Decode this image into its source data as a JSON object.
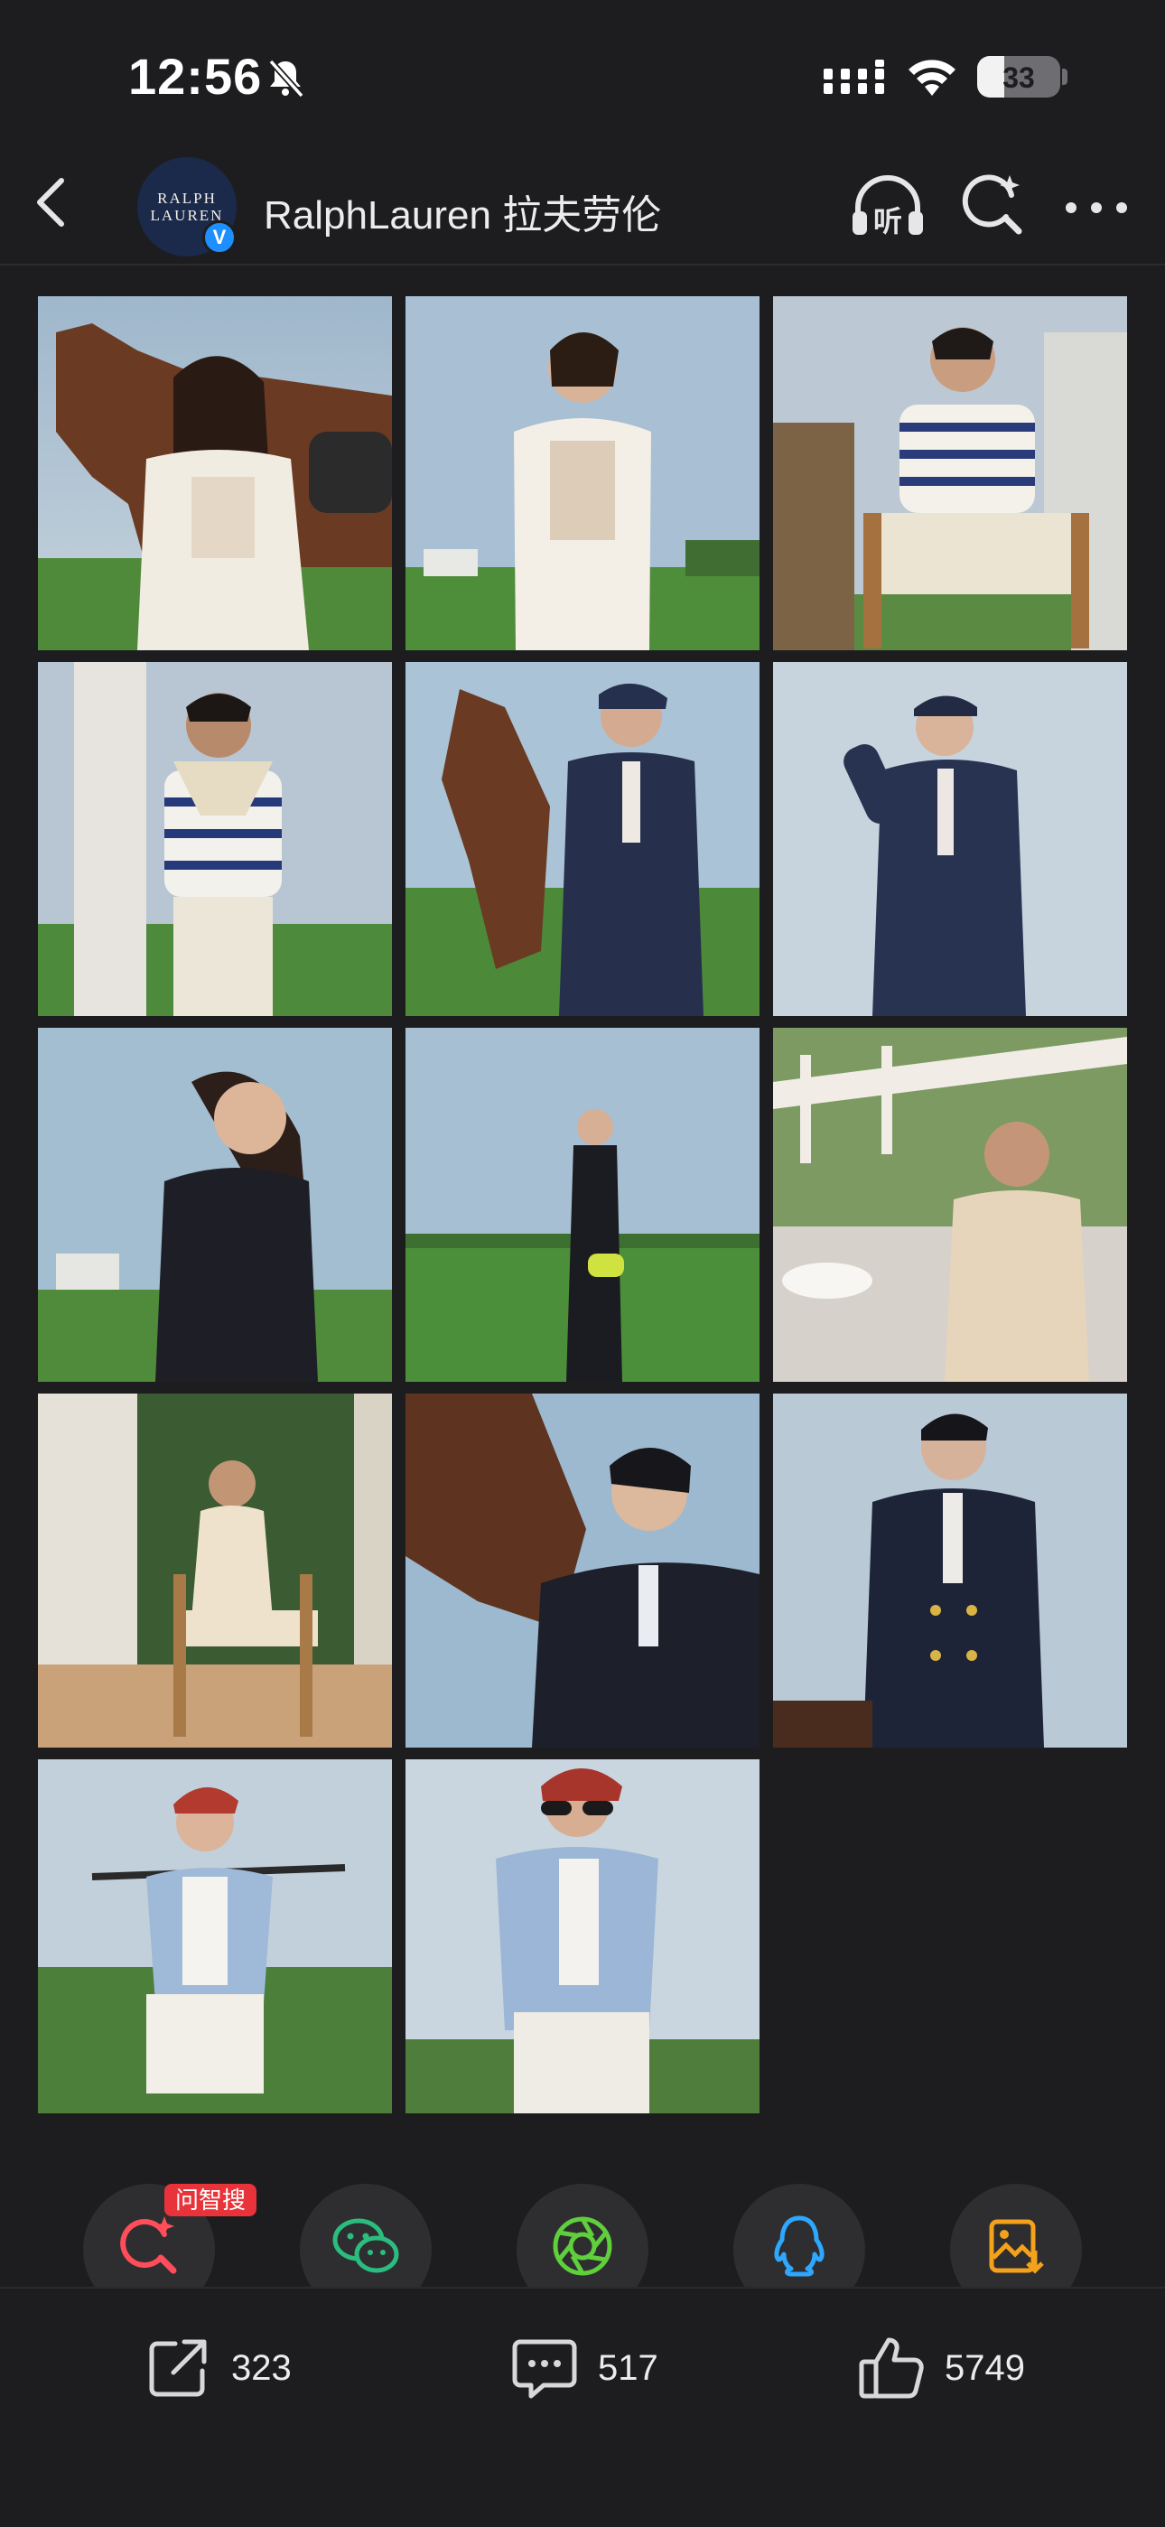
{
  "status_bar": {
    "time": "12:56",
    "battery": "33",
    "battery_level": 0.33,
    "icons": [
      "bell-slash-icon",
      "cellular-signal-icon",
      "wifi-icon",
      "battery-icon"
    ]
  },
  "header": {
    "account_name": "RalphLauren 拉夫劳伦",
    "avatar_text_line1": "RALPH",
    "avatar_text_line2": "LAUREN",
    "verified_mark": "V",
    "listen_icon_text": "听",
    "icons": [
      "back-arrow-icon",
      "listen-icon",
      "ai-search-icon",
      "more-dots-icon"
    ]
  },
  "photos": [
    {
      "subject": "woman-with-horse"
    },
    {
      "subject": "woman-white-outfit-field"
    },
    {
      "subject": "man-striped-sweater-chair"
    },
    {
      "subject": "man-striped-sweater-column"
    },
    {
      "subject": "man-pinstripe-suit-horse"
    },
    {
      "subject": "man-pinstripe-suit-cap"
    },
    {
      "subject": "woman-black-dress-portrait"
    },
    {
      "subject": "woman-black-dress-field"
    },
    {
      "subject": "man-knit-shirt-table"
    },
    {
      "subject": "man-seated-hedge"
    },
    {
      "subject": "man-with-horse-closeup"
    },
    {
      "subject": "man-navy-blazer"
    },
    {
      "subject": "woman-polo-mallet"
    },
    {
      "subject": "woman-sunglasses-denim"
    }
  ],
  "share_row": {
    "badge": "问智搜",
    "targets": [
      "ai-search-share-icon",
      "wechat-icon",
      "moments-icon",
      "qq-icon",
      "save-image-icon"
    ],
    "colors": {
      "ai": "#ff4d5a",
      "wechat": "#2bbd7e",
      "moments": "#5fcf3c",
      "qq": "#2ea8ff",
      "save": "#f4a21b"
    }
  },
  "actions": {
    "share_count": "323",
    "comment_count": "517",
    "like_count": "5749"
  }
}
